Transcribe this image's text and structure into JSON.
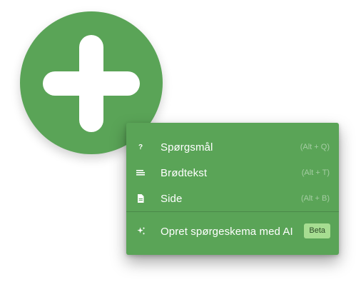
{
  "fab": {
    "icon": "plus-icon"
  },
  "menu": {
    "items": [
      {
        "label": "Spørgsmål",
        "shortcut": "(Alt + Q)",
        "icon": "question-mark-icon"
      },
      {
        "label": "Brødtekst",
        "shortcut": "(Alt + T)",
        "icon": "text-lines-icon"
      },
      {
        "label": "Side",
        "shortcut": "(Alt + B)",
        "icon": "page-icon"
      }
    ],
    "ai_item": {
      "label": "Opret spørgeskema med AI",
      "badge": "Beta",
      "icon": "sparkles-icon"
    }
  },
  "colors": {
    "accent": "#5aa457",
    "badge": "#a6dd91"
  }
}
